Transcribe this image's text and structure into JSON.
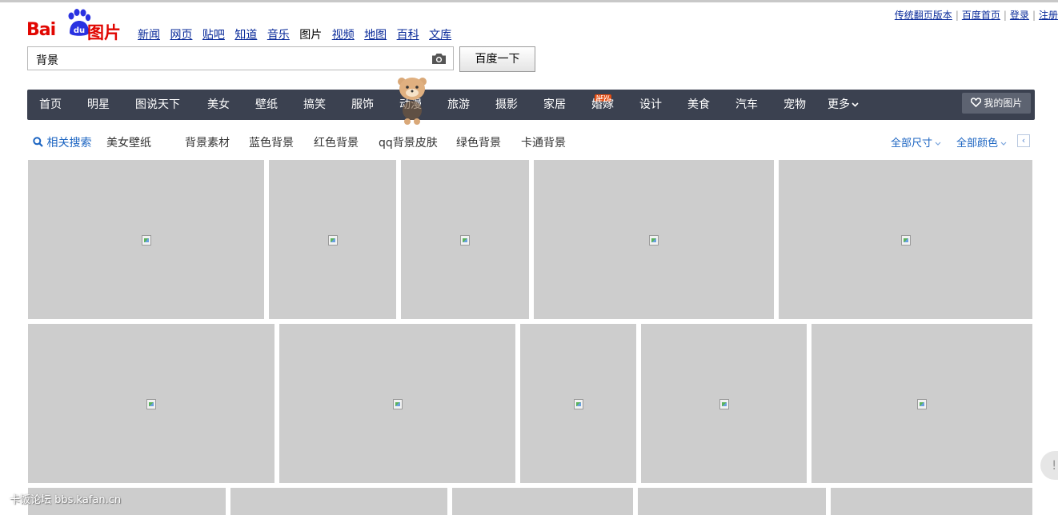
{
  "user_links": [
    "传统翻页版本",
    "百度首页",
    "登录",
    "注册"
  ],
  "logo": {
    "bai": "Bai",
    "du": "du",
    "pic": "图片"
  },
  "channels": {
    "items": [
      "新闻",
      "网页",
      "贴吧",
      "知道",
      "音乐",
      "图片",
      "视频",
      "地图",
      "百科",
      "文库"
    ],
    "current": "图片"
  },
  "search": {
    "query": "背景",
    "button_label": "百度一下"
  },
  "nav": {
    "items": [
      "首页",
      "明星",
      "图说天下",
      "美女",
      "壁纸",
      "搞笑",
      "服饰",
      "动漫",
      "旅游",
      "摄影",
      "家居",
      "婚嫁",
      "设计",
      "美食",
      "汽车",
      "宠物",
      "更多"
    ],
    "new_badge": "NEW",
    "my_pictures": "我的图片"
  },
  "related": {
    "label": "相关搜索",
    "terms": [
      "美女壁纸",
      "背景素材",
      "蓝色背景",
      "红色背景",
      "qq背景皮肤",
      "绿色背景",
      "卡通背景"
    ]
  },
  "filters": {
    "size": "全部尺寸",
    "color": "全部颜色"
  },
  "collapse_glyph": "‹",
  "feedback_glyph": "!",
  "watermark": "卡饭论坛 bbs.kafan.cn",
  "colors": {
    "brand_red": "#e10601",
    "brand_blue": "#2932e1",
    "nav_bg": "#3b4150",
    "link_blue": "#0a2b9a",
    "accent_blue": "#1c65c2",
    "tile_gray": "#cdcdcd"
  },
  "icons": [
    "camera-icon",
    "search-icon",
    "heart-icon",
    "chevron-down-icon",
    "broken-image-icon"
  ]
}
